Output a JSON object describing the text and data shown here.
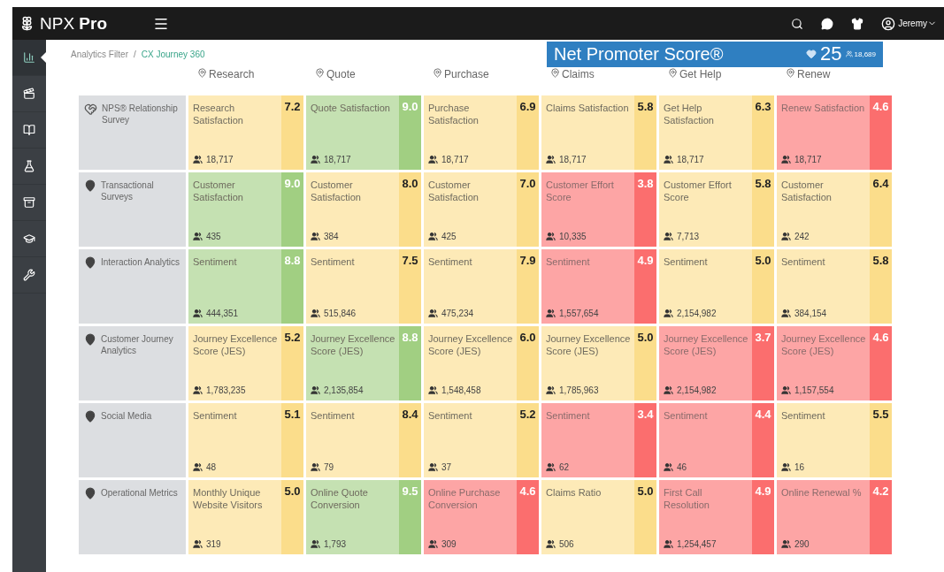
{
  "topbar": {
    "brand": "NPX",
    "brand_bold": "Pro",
    "user": "Jeremy"
  },
  "sidebar": {
    "items": [
      {
        "selected": true
      },
      {
        "selected": false
      },
      {
        "selected": false
      },
      {
        "selected": false
      },
      {
        "selected": false
      },
      {
        "selected": false
      },
      {
        "selected": false
      }
    ]
  },
  "breadcrumb": [
    "Analytics Filter",
    "/",
    "CX Journey 360"
  ],
  "nps": {
    "title": "Net Promoter Score®",
    "score": "25",
    "count": "18,689"
  },
  "columns": [
    "Research",
    "Quote",
    "Purchase",
    "Claims",
    "Get Help",
    "Renew"
  ],
  "rows": [
    {
      "label": "NPS® Relationship Survey",
      "kind": "survey",
      "cells": [
        {
          "metric": "Research Satisfaction",
          "score": "7.2",
          "count": "18,717",
          "color": "#fbdd8b"
        },
        {
          "metric": "Quote Satisfaction",
          "score": "9.0",
          "count": "18,717",
          "color": "#a1cf82"
        },
        {
          "metric": "Purchase Satisfaction",
          "score": "6.9",
          "count": "18,717",
          "color": "#fbdd8b"
        },
        {
          "metric": "Claims Satisfaction",
          "score": "5.8",
          "count": "18,717",
          "color": "#fbdd8b"
        },
        {
          "metric": "Get Help Satisfaction",
          "score": "6.3",
          "count": "18,717",
          "color": "#fbdd8b"
        },
        {
          "metric": "Renew Satisfaction",
          "score": "4.6",
          "count": "18,717",
          "color": "#fb6e6e"
        }
      ]
    },
    {
      "label": "Transactional Surveys",
      "kind": "location",
      "cells": [
        {
          "metric": "Customer Satisfaction",
          "score": "9.0",
          "count": "435",
          "color": "#a1cf82"
        },
        {
          "metric": "Customer Satisfaction",
          "score": "8.0",
          "count": "384",
          "color": "#fbdd8b"
        },
        {
          "metric": "Customer Satisfaction",
          "score": "7.0",
          "count": "425",
          "color": "#fbdd8b"
        },
        {
          "metric": "Customer Effort Score",
          "score": "3.8",
          "count": "10,335",
          "color": "#fb6e6e"
        },
        {
          "metric": "Customer Effort Score",
          "score": "5.8",
          "count": "7,713",
          "color": "#fbdd8b"
        },
        {
          "metric": "Customer Satisfaction",
          "score": "6.4",
          "count": "242",
          "color": "#fbdd8b"
        }
      ]
    },
    {
      "label": "Interaction Analytics",
      "kind": "location",
      "cells": [
        {
          "metric": "Sentiment",
          "score": "8.8",
          "count": "444,351",
          "color": "#a1cf82"
        },
        {
          "metric": "Sentiment",
          "score": "7.5",
          "count": "515,846",
          "color": "#fbdd8b"
        },
        {
          "metric": "Sentiment",
          "score": "7.9",
          "count": "475,234",
          "color": "#fbdd8b"
        },
        {
          "metric": "Sentiment",
          "score": "4.9",
          "count": "1,557,654",
          "color": "#fb6e6e"
        },
        {
          "metric": "Sentiment",
          "score": "5.0",
          "count": "2,154,982",
          "color": "#fbdd8b"
        },
        {
          "metric": "Sentiment",
          "score": "5.8",
          "count": "384,154",
          "color": "#fbdd8b"
        }
      ]
    },
    {
      "label": "Customer Journey Analytics",
      "kind": "location",
      "cells": [
        {
          "metric": "Journey Excellence Score (JES)",
          "score": "5.2",
          "count": "1,783,235",
          "color": "#fbdd8b"
        },
        {
          "metric": "Journey Excellence Score (JES)",
          "score": "8.8",
          "count": "2,135,854",
          "color": "#a1cf82"
        },
        {
          "metric": "Journey Excellence Score (JES)",
          "score": "6.0",
          "count": "1,548,458",
          "color": "#fbdd8b"
        },
        {
          "metric": "Journey Excellence Score (JES)",
          "score": "5.0",
          "count": "1,785,963",
          "color": "#fbdd8b"
        },
        {
          "metric": "Journey Excellence Score (JES)",
          "score": "3.7",
          "count": "2,154,982",
          "color": "#fb6e6e"
        },
        {
          "metric": "Journey Excellence Score (JES)",
          "score": "4.6",
          "count": "1,157,554",
          "color": "#fb6e6e"
        }
      ]
    },
    {
      "label": "Social Media",
      "kind": "location",
      "cells": [
        {
          "metric": "Sentiment",
          "score": "5.1",
          "count": "48",
          "color": "#fbdd8b"
        },
        {
          "metric": "Sentiment",
          "score": "8.4",
          "count": "79",
          "color": "#fbdd8b"
        },
        {
          "metric": "Sentiment",
          "score": "5.2",
          "count": "37",
          "color": "#fbdd8b"
        },
        {
          "metric": "Sentiment",
          "score": "3.4",
          "count": "62",
          "color": "#fb6e6e"
        },
        {
          "metric": "Sentiment",
          "score": "4.4",
          "count": "46",
          "color": "#fb6e6e"
        },
        {
          "metric": "Sentiment",
          "score": "5.5",
          "count": "16",
          "color": "#fbdd8b"
        }
      ]
    },
    {
      "label": "Operational Metrics",
      "kind": "location",
      "cells": [
        {
          "metric": "Monthly Unique Website Visitors",
          "score": "5.0",
          "count": "319",
          "color": "#fbdd8b"
        },
        {
          "metric": "Online Quote Conversion",
          "score": "9.5",
          "count": "1,793",
          "color": "#a1cf82"
        },
        {
          "metric": "Online Purchase Conversion",
          "score": "4.6",
          "count": "309",
          "color": "#fb6e6e"
        },
        {
          "metric": "Claims Ratio",
          "score": "5.0",
          "count": "506",
          "color": "#fbdd8b"
        },
        {
          "metric": "First Call Resolution",
          "score": "4.9",
          "count": "1,254,457",
          "color": "#fb6e6e"
        },
        {
          "metric": "Online Renewal %",
          "score": "4.2",
          "count": "290",
          "color": "#fb6e6e"
        }
      ]
    }
  ]
}
